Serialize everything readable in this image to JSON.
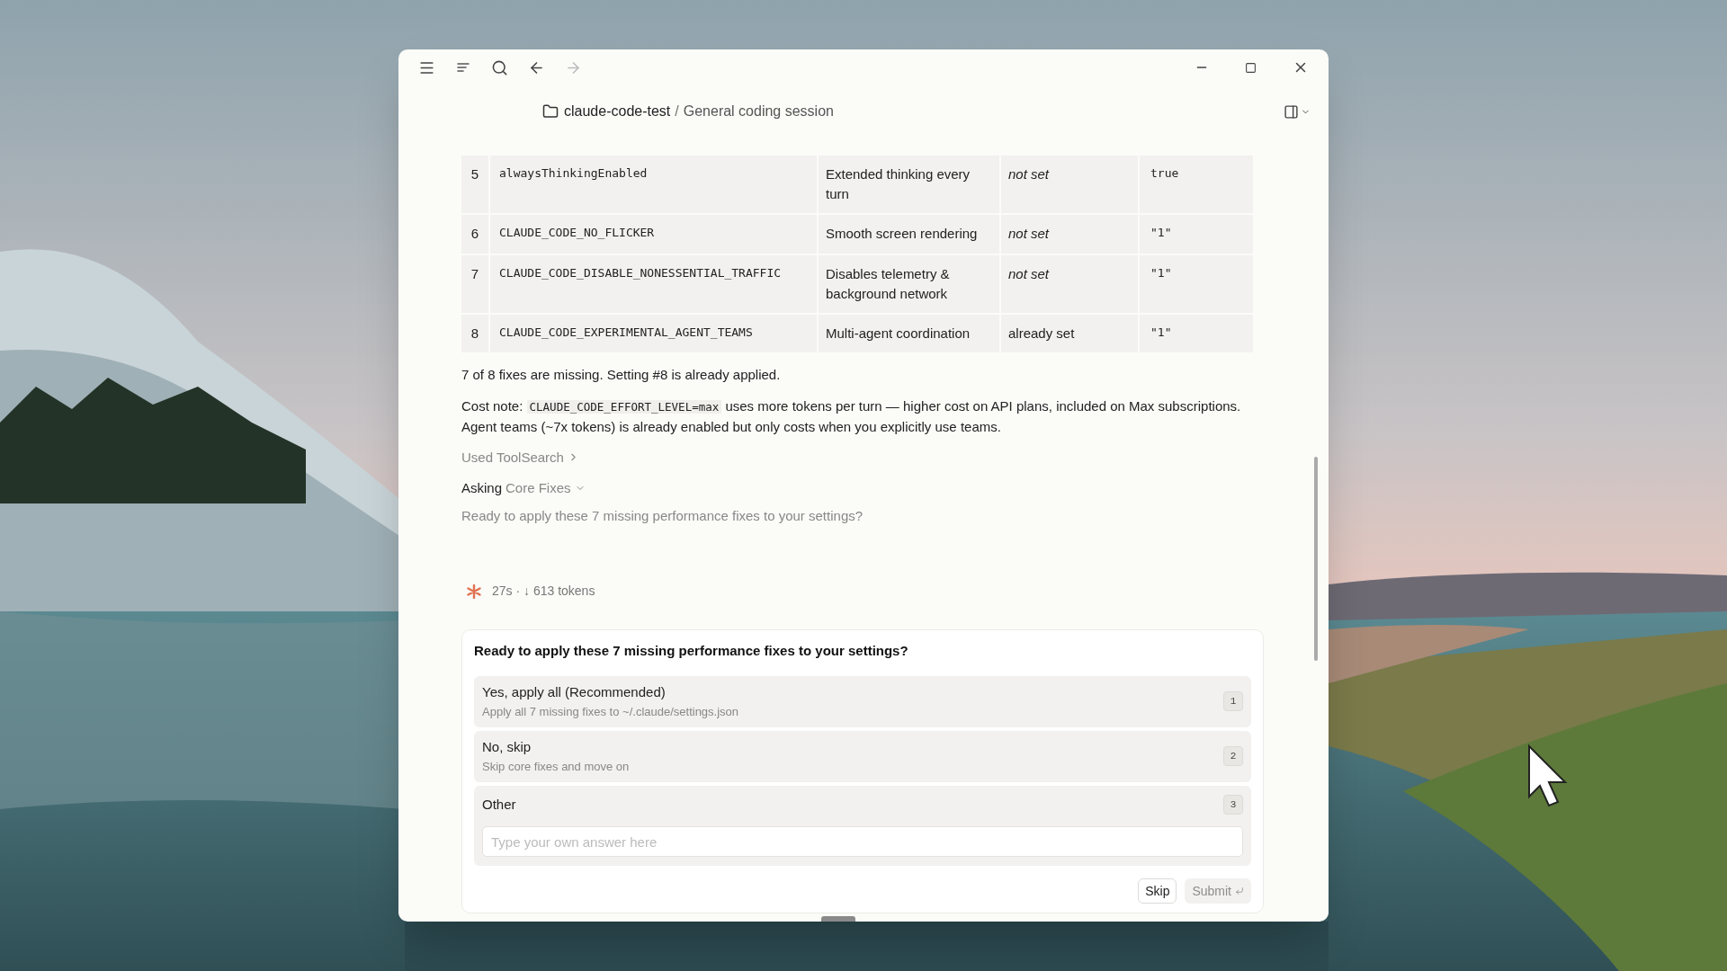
{
  "breadcrumb": {
    "folder": "claude-code-test",
    "separator": "/",
    "session": "General coding session"
  },
  "table": {
    "rows": [
      {
        "number": "5",
        "key": "alwaysThinkingEnabled",
        "description": "Extended thinking every turn",
        "current": "not set",
        "set": false,
        "value": "true"
      },
      {
        "number": "6",
        "key": "CLAUDE_CODE_NO_FLICKER",
        "description": "Smooth screen rendering",
        "current": "not set",
        "set": false,
        "value": "\"1\""
      },
      {
        "number": "7",
        "key": "CLAUDE_CODE_DISABLE_NONESSENTIAL_TRAFFIC",
        "description": "Disables telemetry & background network",
        "current": "not set",
        "set": false,
        "value": "\"1\""
      },
      {
        "number": "8",
        "key": "CLAUDE_CODE_EXPERIMENTAL_AGENT_TEAMS",
        "description": "Multi-agent coordination",
        "current": "already set",
        "set": true,
        "value": "\"1\""
      }
    ]
  },
  "summary": "7 of 8 fixes are missing. Setting #8 is already applied.",
  "cost_note": {
    "lead": "Cost note:",
    "code": "CLAUDE_CODE_EFFORT_LEVEL=max",
    "rest": "uses more tokens per turn — higher cost on API plans, included on Max subscriptions. Agent teams (~7x tokens) is already enabled but only costs when you explicitly use teams."
  },
  "tool_use": {
    "label": "Used ToolSearch"
  },
  "asking": {
    "verb": "Asking",
    "topic": "Core Fixes",
    "question": "Ready to apply these 7 missing performance fixes to your settings?"
  },
  "status": "27s · ↓ 613 tokens",
  "question_card": {
    "title": "Ready to apply these 7 missing performance fixes to your settings?",
    "options": [
      {
        "kind": "choice",
        "label": "Yes, apply all (Recommended)",
        "description": "Apply all 7 missing fixes to ~/.claude/settings.json",
        "shortcut": "1"
      },
      {
        "kind": "choice",
        "label": "No, skip",
        "description": "Skip core fixes and move on",
        "shortcut": "2"
      },
      {
        "kind": "other",
        "label": "Other",
        "shortcut": "3",
        "placeholder": "Type your own answer here"
      }
    ],
    "buttons": [
      {
        "label": "Skip",
        "disabled": false
      },
      {
        "label": "Submit",
        "disabled": true
      }
    ]
  }
}
